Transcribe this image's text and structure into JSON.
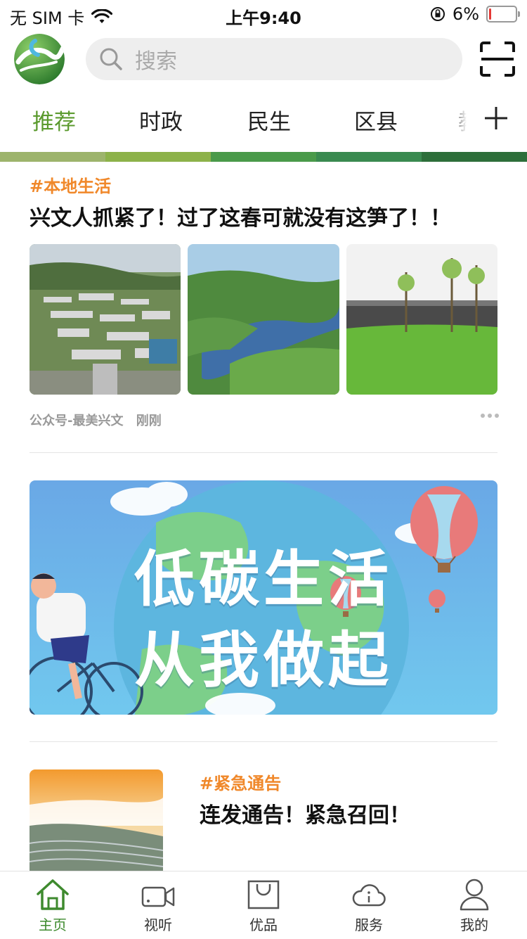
{
  "status_bar": {
    "carrier": "无 SIM 卡",
    "time": "上午9:40",
    "battery_percent": "6%"
  },
  "header": {
    "search_placeholder": "搜索",
    "logo_icon": "app-logo",
    "scan_icon": "scan-icon"
  },
  "tabs": {
    "items": [
      {
        "label": "推荐",
        "active": true
      },
      {
        "label": "时政",
        "active": false
      },
      {
        "label": "民生",
        "active": false
      },
      {
        "label": "区县",
        "active": false
      },
      {
        "label": "教",
        "active": false
      }
    ],
    "colors": [
      "#9db46c",
      "#8db24a",
      "#4a9a4a",
      "#3a8a50",
      "#2d6e3a"
    ]
  },
  "article1": {
    "tag": "#本地生活",
    "title": "兴文人抓紧了！过了这春可就没有这笋了！！",
    "source": "公众号-最美兴文",
    "time": "刚刚"
  },
  "banner": {
    "line1": "低碳生活",
    "line2": "从我做起"
  },
  "article2": {
    "tag": "#紧急通告",
    "title": "连发通告！紧急召回！"
  },
  "bottom_nav": {
    "items": [
      {
        "label": "主页",
        "icon": "home-icon",
        "active": true
      },
      {
        "label": "视听",
        "icon": "video-icon",
        "active": false
      },
      {
        "label": "优品",
        "icon": "shopping-bag-icon",
        "active": false
      },
      {
        "label": "服务",
        "icon": "cloud-info-icon",
        "active": false
      },
      {
        "label": "我的",
        "icon": "user-icon",
        "active": false
      }
    ]
  },
  "colors": {
    "accent": "#5b9a2e",
    "tag_orange": "#f0882a"
  }
}
